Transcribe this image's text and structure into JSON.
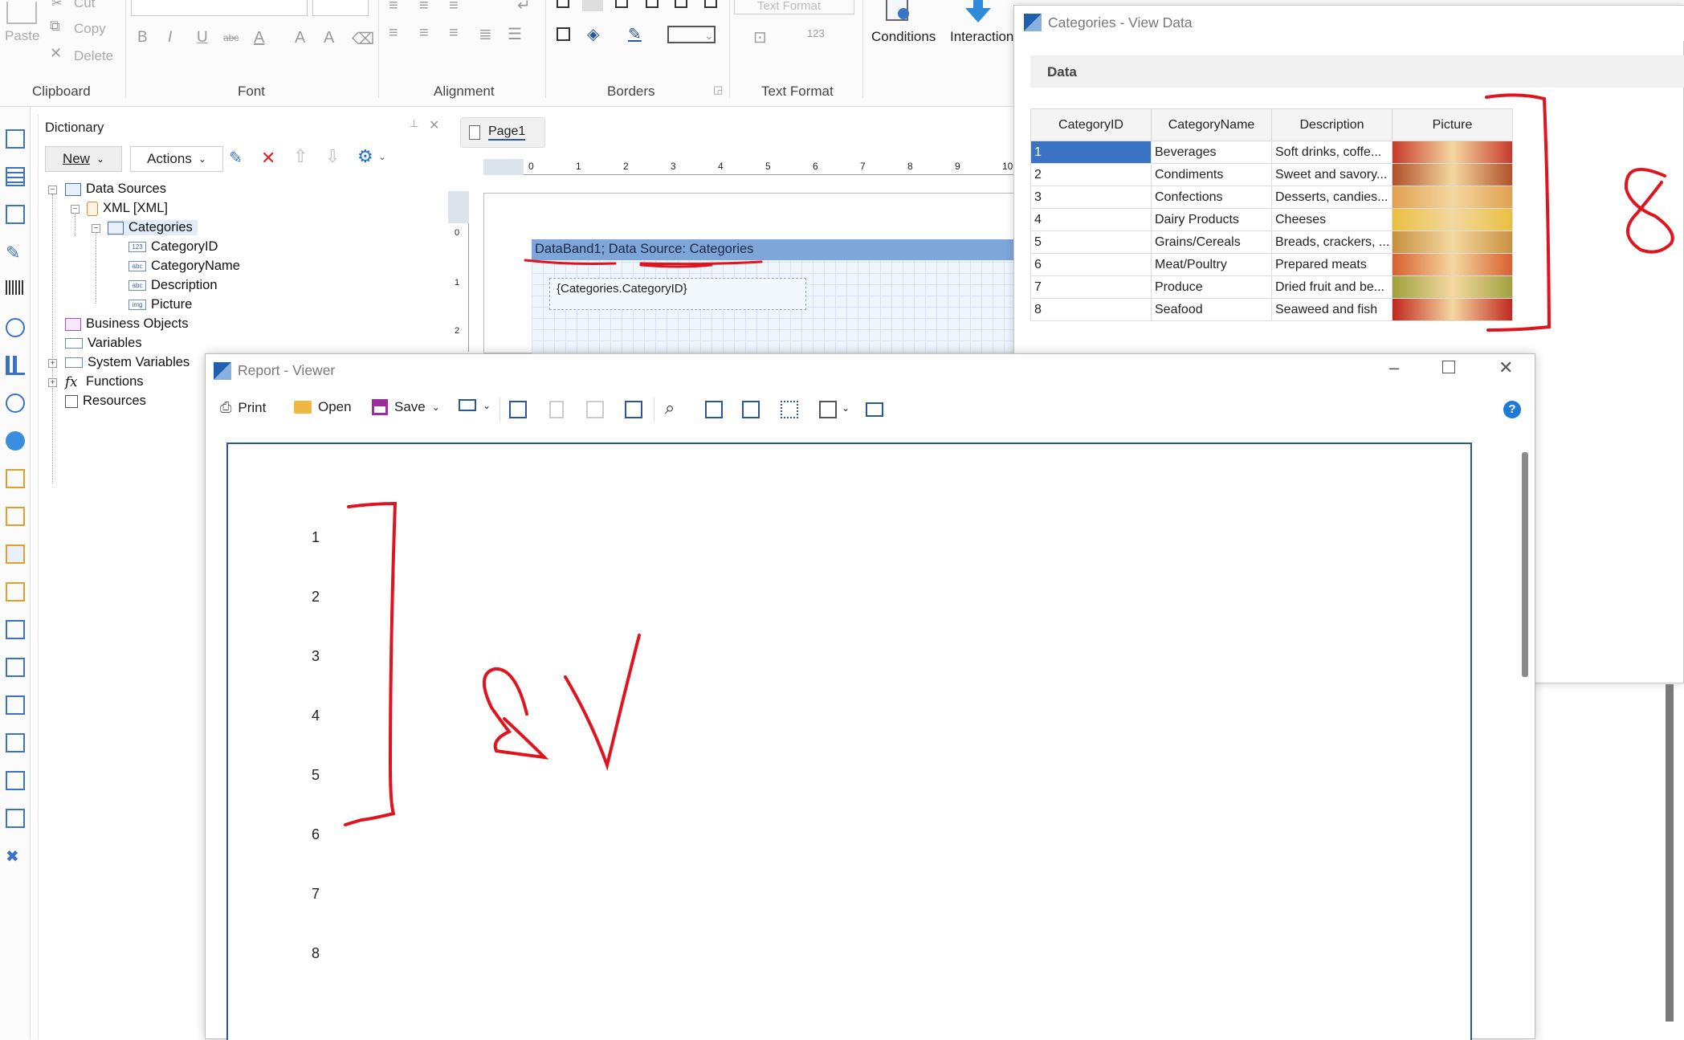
{
  "ribbon": {
    "clipboard": {
      "paste": "Paste",
      "cut": "Cut",
      "copy": "Copy",
      "delete": "Delete",
      "label": "Clipboard"
    },
    "font": {
      "label": "Font",
      "bold": "B",
      "italic": "I",
      "underline": "U",
      "strike": "abc"
    },
    "alignment": {
      "label": "Alignment"
    },
    "borders": {
      "label": "Borders"
    },
    "text_format": {
      "label": "Text Format",
      "button": "Text Format"
    },
    "conditions": "Conditions",
    "interaction": "Interaction"
  },
  "dictionary": {
    "title": "Dictionary",
    "new_button": "New",
    "actions_button": "Actions",
    "tree": {
      "data_sources": "Data Sources",
      "xml": "XML [XML]",
      "categories": "Categories",
      "fields": [
        "CategoryID",
        "CategoryName",
        "Description",
        "Picture"
      ],
      "field_icons": [
        "123",
        "abc",
        "abc",
        "img"
      ],
      "business_objects": "Business Objects",
      "variables": "Variables",
      "system_variables": "System Variables",
      "functions": "Functions",
      "resources": "Resources"
    }
  },
  "designer": {
    "page_tab": "Page1",
    "ruler": [
      "0",
      "1",
      "2",
      "3",
      "4",
      "5",
      "6",
      "7",
      "8",
      "9",
      "10"
    ],
    "vruler": [
      "0",
      "1",
      "2"
    ],
    "databand_header": "DataBand1; Data Source: Categories",
    "field_text": "{Categories.CategoryID}"
  },
  "view_data": {
    "title": "Categories - View Data",
    "section": "Data",
    "columns": [
      "CategoryID",
      "CategoryName",
      "Description",
      "Picture"
    ],
    "rows": [
      {
        "id": "1",
        "name": "Beverages",
        "desc": "Soft drinks, coffe..."
      },
      {
        "id": "2",
        "name": "Condiments",
        "desc": "Sweet and savory..."
      },
      {
        "id": "3",
        "name": "Confections",
        "desc": "Desserts, candies..."
      },
      {
        "id": "4",
        "name": "Dairy Products",
        "desc": "Cheeses"
      },
      {
        "id": "5",
        "name": "Grains/Cereals",
        "desc": "Breads, crackers, ..."
      },
      {
        "id": "6",
        "name": "Meat/Poultry",
        "desc": "Prepared meats"
      },
      {
        "id": "7",
        "name": "Produce",
        "desc": "Dried fruit and be..."
      },
      {
        "id": "8",
        "name": "Seafood",
        "desc": "Seaweed and fish"
      }
    ],
    "picture_colors": [
      "#c83a2a",
      "#b0502a",
      "#e0a050",
      "#e8c040",
      "#c89040",
      "#d86030",
      "#a0a040",
      "#c02820"
    ],
    "annotation": "8"
  },
  "viewer": {
    "title": "Report - Viewer",
    "toolbar": {
      "print": "Print",
      "open": "Open",
      "save": "Save"
    },
    "help": "?",
    "values": [
      "1",
      "2",
      "3",
      "4",
      "5",
      "6",
      "7",
      "8"
    ]
  },
  "colors": {
    "accent": "#2b579a",
    "selection": "#3a72c4",
    "annotation": "#e0141e",
    "band": "#7fa6d9"
  }
}
